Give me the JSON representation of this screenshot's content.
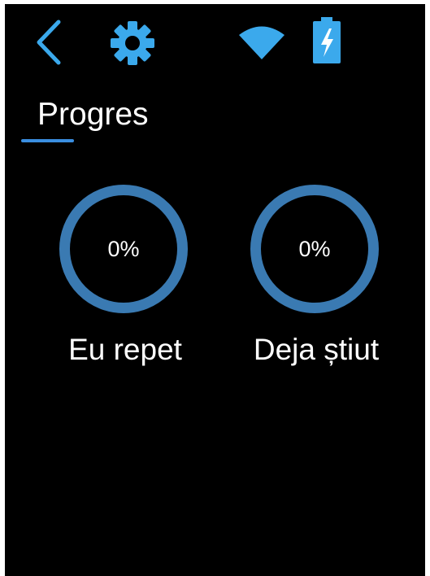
{
  "colors": {
    "accent": "#3a8ee0",
    "ring": "#3a7ab2",
    "icon": "#3ba9ec",
    "background": "#000000",
    "text": "#ffffff"
  },
  "topbar": {
    "icons": [
      "chevron-left-icon",
      "gear-icon",
      "wifi-icon",
      "battery-charging-icon"
    ]
  },
  "header": {
    "title": "Progres"
  },
  "progress": [
    {
      "label": "Eu repet",
      "value_text": "0%",
      "value": 0
    },
    {
      "label": "Deja știut",
      "value_text": "0%",
      "value": 0
    }
  ]
}
